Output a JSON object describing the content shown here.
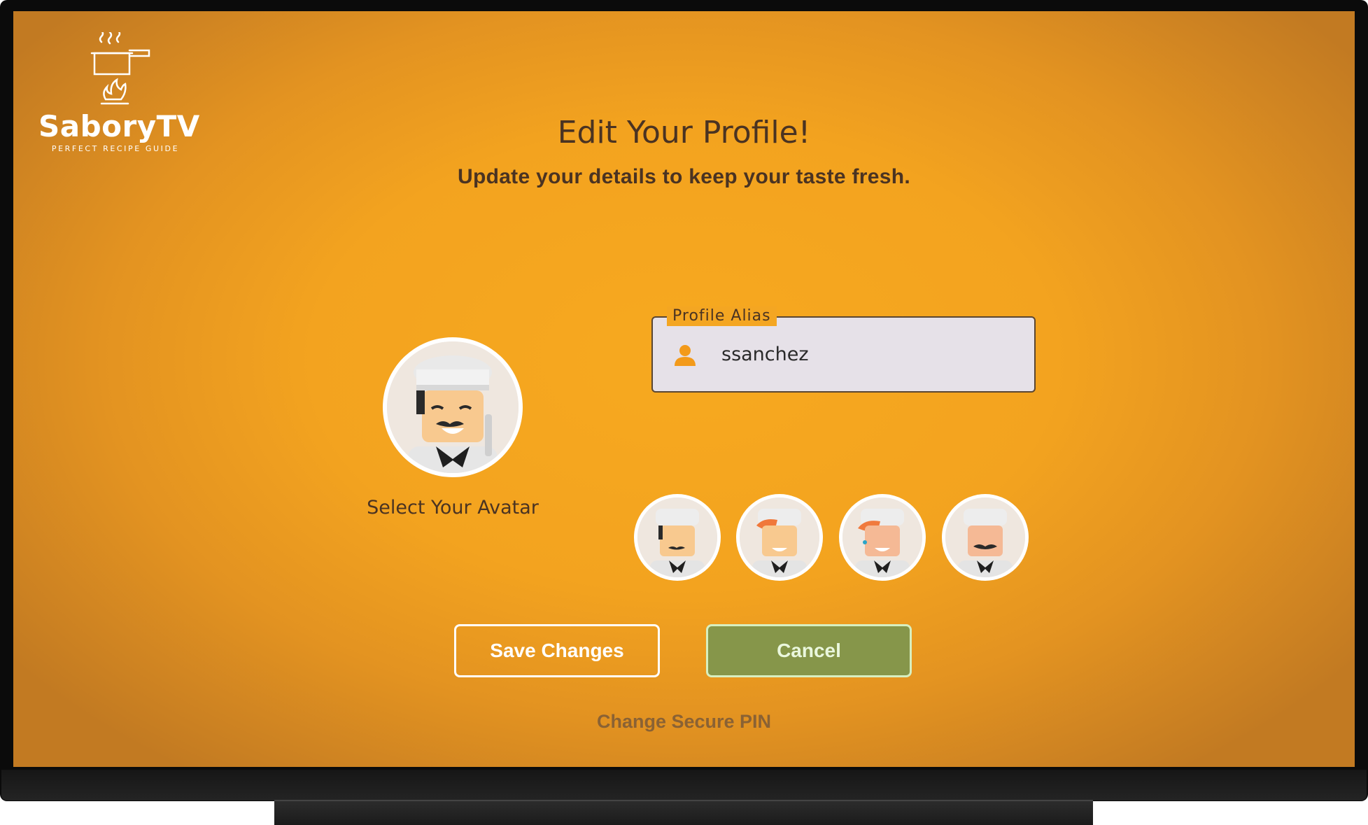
{
  "brand": {
    "name": "SaboryTV",
    "tagline": "PERFECT RECIPE GUIDE"
  },
  "header": {
    "title": "Edit Your Profile!",
    "subtitle": "Update your details to keep your taste fresh."
  },
  "avatar": {
    "label": "Select Your Avatar",
    "selected_icon": "chef-avatar-icon"
  },
  "alias": {
    "label": "Profile Alias",
    "value": "ssanchez",
    "icon": "person-icon"
  },
  "avatar_options": [
    {
      "name": "chef-mustache-hat"
    },
    {
      "name": "chef-woman-red-hair"
    },
    {
      "name": "chef-woman-orange-hair"
    },
    {
      "name": "chef-man-big-mustache"
    }
  ],
  "actions": {
    "save_label": "Save Changes",
    "cancel_label": "Cancel",
    "pin_label": "Change Secure PIN"
  },
  "colors": {
    "background": "#f4a622",
    "cancel_button": "#86964a",
    "text_dark": "#4a3322",
    "link": "#8a6234"
  }
}
